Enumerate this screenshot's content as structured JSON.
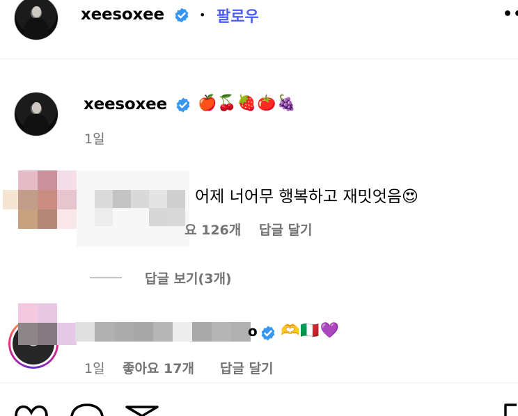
{
  "header": {
    "username": "xeesoxee",
    "separator": "•",
    "follow_label": "팔로우",
    "more_label": "••"
  },
  "caption": {
    "username": "xeesoxee",
    "emojis": "🍎🍒🍓🍅🍇",
    "time": "1일"
  },
  "comment1": {
    "text": "어제 너어무 행복하고 재밋엇음😍",
    "likes_fragment": "요 126개",
    "reply_label": "답글 달기",
    "view_replies": "답글 보기(3개)"
  },
  "comment2": {
    "username_tail": "o",
    "emojis": "🫶🇮🇹💜",
    "time": "1일",
    "likes": "좋아요 17개",
    "reply_label": "답글 달기"
  },
  "colors": {
    "accent": "#4a5df9",
    "verified": "#3797f0",
    "secondary_text": "#737373"
  },
  "icons": {
    "like": "heart-icon",
    "comment": "comment-icon",
    "share": "paper-plane-icon",
    "save": "bookmark-icon",
    "verified": "verified-badge-icon",
    "more": "more-options-icon"
  }
}
